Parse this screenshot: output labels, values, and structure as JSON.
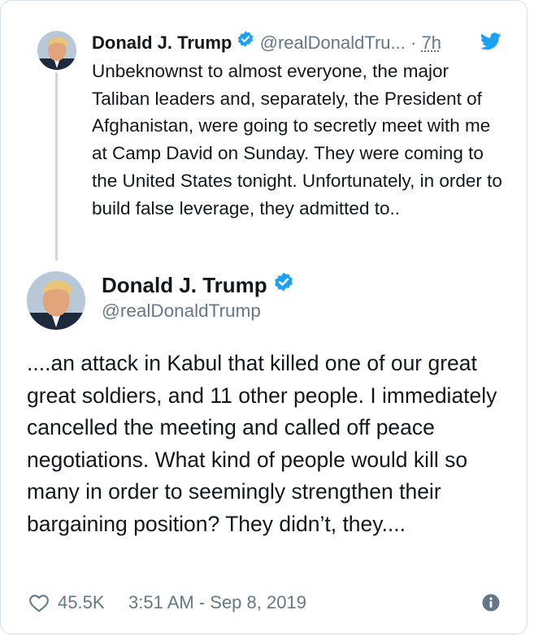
{
  "parent_tweet": {
    "author_name": "Donald J. Trump",
    "handle": "@realDonaldTru...",
    "separator": "·",
    "time": "7h",
    "text": "Unbeknownst to almost everyone, the major Taliban leaders and, separately, the President of Afghanistan, were going to secretly meet with me at Camp David on Sunday. They were coming to the United States tonight. Unfortunately, in order to build false leverage, they admitted to.."
  },
  "main_tweet": {
    "author_name": "Donald J. Trump",
    "handle": "@realDonaldTrump",
    "text": "....an attack in Kabul that killed one of our great great soldiers, and 11 other people. I immediately cancelled the meeting and called off peace negotiations. What kind of people would kill so many in order to seemingly strengthen their bargaining position? They didn’t, they....",
    "likes": "45.5K",
    "timestamp": "3:51 AM - Sep 8, 2019"
  },
  "icons": {
    "verified": "verified-badge-icon",
    "twitter": "twitter-bird-icon",
    "like": "heart-outline-icon",
    "info": "info-circle-icon"
  },
  "colors": {
    "accent": "#1da1f2",
    "text": "#14171a",
    "muted": "#657786",
    "border": "#d6dde3"
  }
}
